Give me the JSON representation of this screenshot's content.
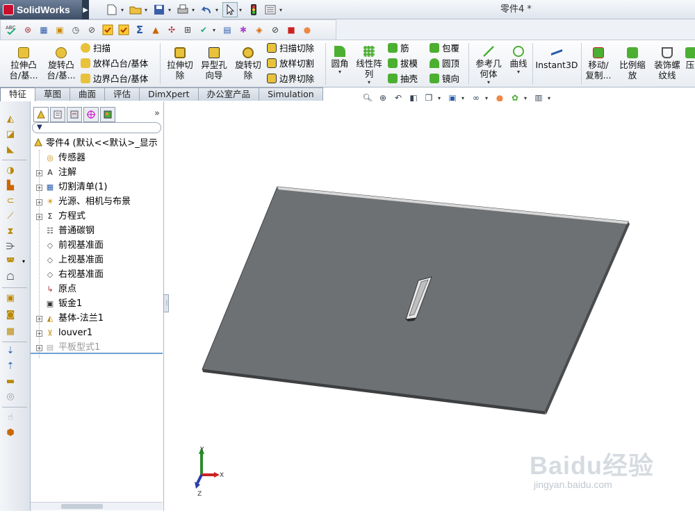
{
  "app": {
    "logo_text": "SolidWorks",
    "document_title": "零件4 *"
  },
  "quick_access": {
    "icons": [
      "new-icon",
      "open-icon",
      "save-icon",
      "print-icon",
      "undo-icon",
      "select-icon",
      "rebuild-icon",
      "options-icon"
    ]
  },
  "command_manager": {
    "extrude_boss": "拉伸凸\n台/基...",
    "revolve_boss": "旋转凸\n台/基...",
    "sweep": "扫描",
    "loft_boss": "放样凸台/基体",
    "boundary_boss": "边界凸台/基体",
    "extrude_cut": "拉伸切\n除",
    "hole_wizard": "异型孔\n向导",
    "revolve_cut": "旋转切\n除",
    "swept_cut": "扫描切除",
    "lofted_cut": "放样切割",
    "boundary_cut": "边界切除",
    "fillet": "圆角",
    "linear_pattern": "线性阵\n列",
    "rib": "筋",
    "draft": "拔模",
    "shell": "抽壳",
    "wrap": "包覆",
    "dome": "圆顶",
    "mirror": "镜向",
    "ref_geometry": "参考几\n何体",
    "curves": "曲线",
    "instant3d": "Instant3D",
    "move_copy": "移动/\n复制...",
    "scale": "比例缩\n放",
    "cosmetic_thread": "装饰螺\n纹线",
    "cut_off": "压"
  },
  "tabs": [
    "特征",
    "草图",
    "曲面",
    "评估",
    "DimXpert",
    "办公室产品",
    "Simulation"
  ],
  "active_tab": "特征",
  "feature_tree": {
    "root": "零件4  (默认<<默认>_显示",
    "items": [
      {
        "label": "传感器",
        "icon": "sensor-icon",
        "expandable": false
      },
      {
        "label": "注解",
        "icon": "annotation-icon",
        "expandable": true
      },
      {
        "label": "切割清单(1)",
        "icon": "cut-list-icon",
        "expandable": true
      },
      {
        "label": "光源、相机与布景",
        "icon": "lights-icon",
        "expandable": true
      },
      {
        "label": "方程式",
        "icon": "equations-icon",
        "expandable": true
      },
      {
        "label": "普通碳钢",
        "icon": "material-icon",
        "expandable": false
      },
      {
        "label": "前视基准面",
        "icon": "plane-icon",
        "expandable": false
      },
      {
        "label": "上视基准面",
        "icon": "plane-icon",
        "expandable": false
      },
      {
        "label": "右视基准面",
        "icon": "plane-icon",
        "expandable": false
      },
      {
        "label": "原点",
        "icon": "origin-icon",
        "expandable": false
      },
      {
        "label": "钣金1",
        "icon": "sheet-metal-icon",
        "expandable": false
      },
      {
        "label": "基体-法兰1",
        "icon": "base-flange-icon",
        "expandable": true
      },
      {
        "label": "louver1",
        "icon": "louver-icon",
        "expandable": true
      },
      {
        "label": "平板型式1",
        "icon": "flat-pattern-icon",
        "expandable": true,
        "suppressed": true
      }
    ]
  },
  "triad": {
    "x_label": "X",
    "y_label": "Y",
    "z_label": "Z"
  },
  "watermark": {
    "brand": "Baidu经验",
    "url": "jingyan.baidu.com"
  },
  "colors": {
    "plate": "#6e7174",
    "plate_edge": "#d8d8d8",
    "accent": "#2a5caa"
  }
}
